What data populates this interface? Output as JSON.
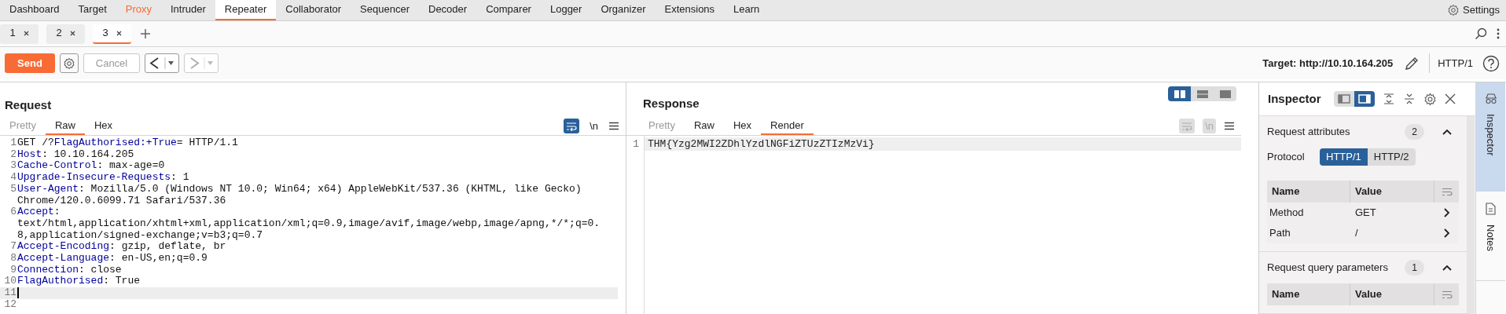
{
  "nav_tabs": [
    {
      "label": "Dashboard",
      "selected": false,
      "highlighted": false
    },
    {
      "label": "Target",
      "selected": false,
      "highlighted": false
    },
    {
      "label": "Proxy",
      "selected": false,
      "highlighted": true
    },
    {
      "label": "Intruder",
      "selected": false,
      "highlighted": false
    },
    {
      "label": "Repeater",
      "selected": true,
      "highlighted": false
    },
    {
      "label": "Collaborator",
      "selected": false,
      "highlighted": false
    },
    {
      "label": "Sequencer",
      "selected": false,
      "highlighted": false
    },
    {
      "label": "Decoder",
      "selected": false,
      "highlighted": false
    },
    {
      "label": "Comparer",
      "selected": false,
      "highlighted": false
    },
    {
      "label": "Logger",
      "selected": false,
      "highlighted": false
    },
    {
      "label": "Organizer",
      "selected": false,
      "highlighted": false
    },
    {
      "label": "Extensions",
      "selected": false,
      "highlighted": false
    },
    {
      "label": "Learn",
      "selected": false,
      "highlighted": false
    }
  ],
  "settings": {
    "label": "Settings"
  },
  "repeater_tabs": [
    {
      "label": "1",
      "selected": false
    },
    {
      "label": "2",
      "selected": false
    },
    {
      "label": "3",
      "selected": true
    }
  ],
  "toolbar": {
    "send": "Send",
    "cancel": "Cancel",
    "target": "Target: http://10.10.164.205",
    "protocol": "HTTP/1"
  },
  "request": {
    "title": "Request",
    "view_tabs": [
      {
        "label": "Pretty",
        "selected": false,
        "disabled": true
      },
      {
        "label": "Raw",
        "selected": true,
        "disabled": false
      },
      {
        "label": "Hex",
        "selected": false,
        "disabled": false
      }
    ],
    "wrap": {
      "selected": true,
      "disabled": false
    },
    "newline": {
      "label": "\\n",
      "disabled": false
    },
    "lines": [
      {
        "number": "1",
        "current": false,
        "parts": [
          {
            "text": "GET /?",
            "kind": "plain"
          },
          {
            "text": "FlagAuthorised:+True",
            "kind": "name"
          },
          {
            "text": "= HTTP/1.1",
            "kind": "plain"
          }
        ]
      },
      {
        "number": "2",
        "current": false,
        "parts": [
          {
            "text": "Host",
            "kind": "name"
          },
          {
            "text": ": 10.10.164.205",
            "kind": "plain"
          }
        ]
      },
      {
        "number": "3",
        "current": false,
        "parts": [
          {
            "text": "Cache-Control",
            "kind": "name"
          },
          {
            "text": ": max-age=0",
            "kind": "plain"
          }
        ]
      },
      {
        "number": "4",
        "current": false,
        "parts": [
          {
            "text": "Upgrade-Insecure-Requests",
            "kind": "name"
          },
          {
            "text": ": 1",
            "kind": "plain"
          }
        ]
      },
      {
        "number": "5",
        "current": false,
        "parts": [
          {
            "text": "User-Agent",
            "kind": "name"
          },
          {
            "text": ": Mozilla/5.0 (Windows NT 10.0; Win64; x64) AppleWebKit/537.36 (KHTML, like Gecko) Chrome/120.0.6099.71 Safari/537.36",
            "kind": "plain"
          }
        ]
      },
      {
        "number": "6",
        "current": false,
        "parts": [
          {
            "text": "Accept",
            "kind": "name"
          },
          {
            "text": ": text/html,application/xhtml+xml,application/xml;q=0.9,image/avif,image/webp,image/apng,*/*;q=0.8,application/signed-exchange;v=b3;q=0.7",
            "kind": "plain"
          }
        ]
      },
      {
        "number": "7",
        "current": false,
        "parts": [
          {
            "text": "Accept-Encoding",
            "kind": "name"
          },
          {
            "text": ": gzip, deflate, br",
            "kind": "plain"
          }
        ]
      },
      {
        "number": "8",
        "current": false,
        "parts": [
          {
            "text": "Accept-Language",
            "kind": "name"
          },
          {
            "text": ": en-US,en;q=0.9",
            "kind": "plain"
          }
        ]
      },
      {
        "number": "9",
        "current": false,
        "parts": [
          {
            "text": "Connection",
            "kind": "name"
          },
          {
            "text": ": close",
            "kind": "plain"
          }
        ]
      },
      {
        "number": "10",
        "current": false,
        "parts": [
          {
            "text": "FlagAuthorised",
            "kind": "name"
          },
          {
            "text": ": True",
            "kind": "plain"
          }
        ]
      },
      {
        "number": "11",
        "current": true
      },
      {
        "number": "12",
        "current": false
      }
    ]
  },
  "response": {
    "title": "Response",
    "layout_options": [
      {
        "kind": "columns",
        "selected": true
      },
      {
        "kind": "rows",
        "selected": false
      },
      {
        "kind": "tabs",
        "selected": false
      }
    ],
    "view_tabs": [
      {
        "label": "Pretty",
        "selected": false,
        "disabled": true
      },
      {
        "label": "Raw",
        "selected": false,
        "disabled": false
      },
      {
        "label": "Hex",
        "selected": false,
        "disabled": false
      },
      {
        "label": "Render",
        "selected": true,
        "disabled": false
      }
    ],
    "wrap": {
      "selected": false,
      "disabled": true
    },
    "newline": {
      "label": "\\n",
      "disabled": true
    },
    "lines": [
      {
        "number": "1",
        "current": true,
        "text": "THM{Yzg2MWI2ZDhlYzdlNGFiZTUzZTIzMzVi}"
      }
    ]
  },
  "inspector": {
    "title": "Inspector",
    "layout_options": [
      {
        "kind": "left",
        "selected": false
      },
      {
        "kind": "right",
        "selected": true
      }
    ],
    "sections": [
      {
        "title": "Request attributes",
        "count": "2",
        "expanded": true,
        "protocol": {
          "label": "Protocol",
          "options": [
            {
              "label": "HTTP/1",
              "selected": true
            },
            {
              "label": "HTTP/2",
              "selected": false
            }
          ]
        },
        "columns": [
          "Name",
          "Value"
        ],
        "rows": [
          {
            "name": "Method",
            "value": "GET"
          },
          {
            "name": "Path",
            "value": "/"
          }
        ]
      },
      {
        "title": "Request query parameters",
        "count": "1",
        "expanded": true,
        "columns": [
          "Name",
          "Value"
        ]
      }
    ]
  },
  "side_tabs": [
    {
      "label": "Inspector",
      "kind": "inspector",
      "selected": true
    },
    {
      "label": "Notes",
      "kind": "notes",
      "selected": false
    }
  ]
}
